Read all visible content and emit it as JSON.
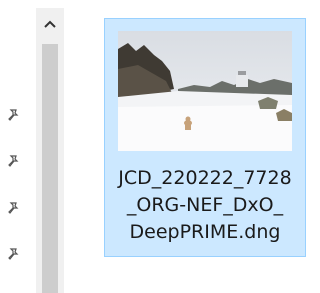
{
  "nav_pins": {
    "icon": "pin-icon",
    "count": 4
  },
  "scrollbar": {
    "up_icon": "chevron-up-icon"
  },
  "file": {
    "name_line1": "JCD_220222_7728",
    "name_line2": "_ORG-NEF_DxO_",
    "name_line3": "DeepPRIME.dng",
    "selected_bg": "#cce8ff",
    "thumbnail_icon": "image-thumbnail"
  }
}
